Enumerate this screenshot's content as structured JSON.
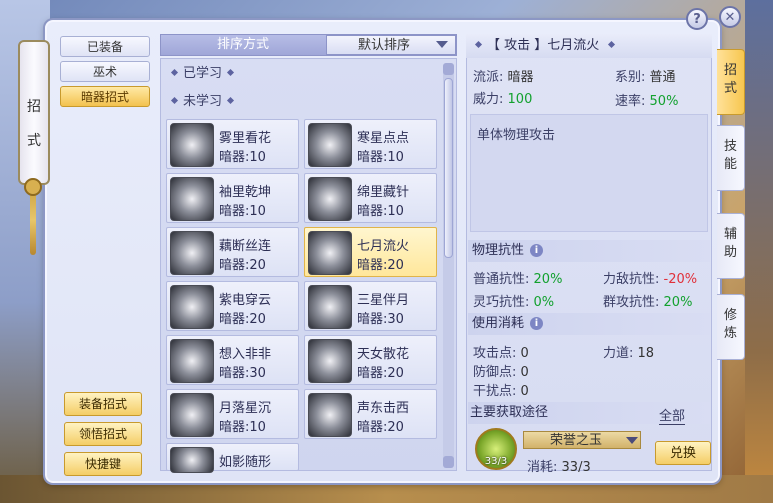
{
  "window": {
    "scroll_label": "招式"
  },
  "categories": [
    {
      "label": "已装备",
      "active": false
    },
    {
      "label": "巫术",
      "active": false
    },
    {
      "label": "暗器招式",
      "active": true
    }
  ],
  "actions": [
    {
      "label": "装备招式"
    },
    {
      "label": "领悟招式"
    },
    {
      "label": "快捷键"
    }
  ],
  "sort": {
    "label": "排序方式",
    "selected": "默认排序"
  },
  "groups": {
    "learned": "已学习",
    "unlearned": "未学习"
  },
  "skills": [
    {
      "name": "雾里看花",
      "sub": "暗器:10",
      "selected": false
    },
    {
      "name": "寒星点点",
      "sub": "暗器:10",
      "selected": false
    },
    {
      "name": "袖里乾坤",
      "sub": "暗器:10",
      "selected": false
    },
    {
      "name": "绵里藏针",
      "sub": "暗器:10",
      "selected": false
    },
    {
      "name": "藕断丝连",
      "sub": "暗器:20",
      "selected": false
    },
    {
      "name": "七月流火",
      "sub": "暗器:20",
      "selected": true
    },
    {
      "name": "紫电穿云",
      "sub": "暗器:20",
      "selected": false
    },
    {
      "name": "三星伴月",
      "sub": "暗器:30",
      "selected": false
    },
    {
      "name": "想入非非",
      "sub": "暗器:30",
      "selected": false
    },
    {
      "name": "天女散花",
      "sub": "暗器:20",
      "selected": false
    },
    {
      "name": "月落星沉",
      "sub": "暗器:10",
      "selected": false
    },
    {
      "name": "声东击西",
      "sub": "暗器:20",
      "selected": false
    },
    {
      "name": "如影随形",
      "sub": "",
      "selected": false
    }
  ],
  "detail": {
    "title": "【 攻击 】七月流火",
    "school_label": "流派:",
    "school_value": "暗器",
    "series_label": "系别:",
    "series_value": "普通",
    "power_label": "威力:",
    "power_value": "100",
    "speed_label": "速率:",
    "speed_value": "50%",
    "description": "单体物理攻击",
    "resist_title": "物理抗性",
    "normal_resist_label": "普通抗性:",
    "normal_resist_value": "20%",
    "force_resist_label": "力敌抗性:",
    "force_resist_value": "-20%",
    "agile_resist_label": "灵巧抗性:",
    "agile_resist_value": "0%",
    "group_resist_label": "群攻抗性:",
    "group_resist_value": "20%",
    "cost_title": "使用消耗",
    "attack_pts_label": "攻击点:",
    "attack_pts_value": "0",
    "strength_label": "力道:",
    "strength_value": "18",
    "defense_pts_label": "防御点:",
    "defense_pts_value": "0",
    "disrupt_pts_label": "干扰点:",
    "disrupt_pts_value": "0",
    "source_title": "主要获取途径",
    "source_all": "全部",
    "item_name": "荣誉之玉",
    "item_count": "33/3",
    "consume_label": "消耗:",
    "consume_value": "33/3",
    "exchange_label": "兑换"
  },
  "side_tabs": [
    {
      "label": "招\n式",
      "active": true
    },
    {
      "label": "技\n能",
      "active": false
    },
    {
      "label": "辅\n助",
      "active": false
    },
    {
      "label": "修\n炼",
      "active": false
    }
  ],
  "top_buttons": {
    "help": "?",
    "close": "✕"
  },
  "colors": {
    "accent_gold": "#f4cd66",
    "positive": "#12a12e",
    "negative": "#e0303a"
  }
}
